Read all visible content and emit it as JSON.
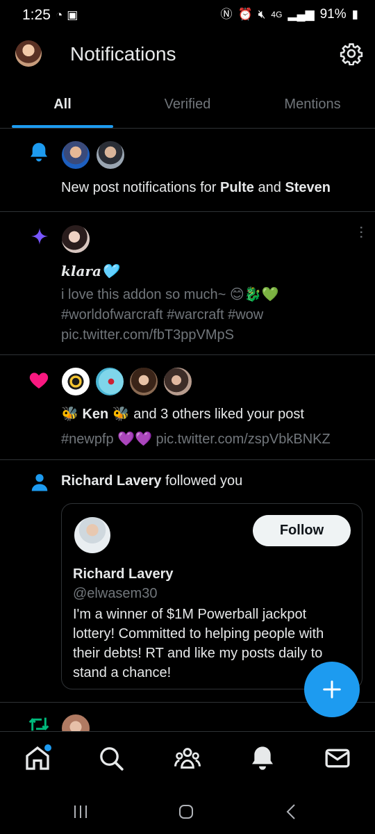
{
  "status_bar": {
    "time": "1:25",
    "battery": "91%",
    "network": "4G"
  },
  "header": {
    "title": "Notifications"
  },
  "tabs": [
    "All",
    "Verified",
    "Mentions"
  ],
  "notifications": {
    "n1": {
      "pre": "New post notifications for ",
      "name1": "Pulte",
      "mid": " and ",
      "name2": "Steven"
    },
    "n2": {
      "author": "klara🩵",
      "line1": "i love this addon so much~ 😊🐉💚",
      "line2": "#worldofwarcraft #warcraft #wow",
      "line3": "pic.twitter.com/fbT3ppVMpS"
    },
    "n3": {
      "name": "🐝 Ken 🐝",
      "rest": " and 3 others liked your post",
      "line2": "#newpfp 💜💜 pic.twitter.com/zspVbkBNKZ"
    },
    "n4": {
      "name": "Richard Lavery",
      "rest": " followed you",
      "card": {
        "display_name": "Richard Lavery",
        "handle": "@elwasem30",
        "bio": [
          "I'm a winner of $1M Powerball jackpot",
          "lottery! Committed to helping people with",
          "their debts! RT and like my posts daily to",
          "stand a chance!"
        ],
        "follow_label": "Follow"
      }
    }
  },
  "colors": {
    "accent": "#1d9bf0",
    "like": "#f91880",
    "spark": "#7856ff",
    "retweet": "#00ba7c"
  },
  "icons": [
    "bell-icon",
    "sparkle-icon",
    "heart-icon",
    "person-icon",
    "retweet-icon",
    "home-icon",
    "search-icon",
    "communities-icon",
    "notifications-icon",
    "messages-icon",
    "gear-icon",
    "plus-icon"
  ]
}
